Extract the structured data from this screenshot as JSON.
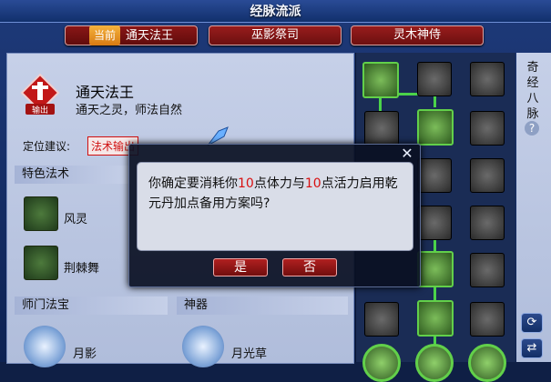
{
  "window": {
    "title": "经脉流派"
  },
  "tabs": [
    {
      "prefix": "当前",
      "label": "通天法王"
    },
    {
      "label": "巫影祭司"
    },
    {
      "label": "灵木神侍"
    }
  ],
  "class_info": {
    "name": "通天法王",
    "description": "通天之灵，师法自然",
    "icon_caption": "输出",
    "position_label": "定位建议:",
    "position_badge": "法术输出"
  },
  "sections": {
    "special_spells": "特色法术",
    "sect_treasure": "师门法宝",
    "artifact": "神器"
  },
  "skills": [
    {
      "label": "风灵",
      "icon": "whirlwind-icon"
    },
    {
      "label": "荆棘舞",
      "icon": "thorn-dance-icon"
    }
  ],
  "treasures": [
    {
      "label": "月影",
      "icon": "moon-shadow-icon"
    },
    {
      "label": "月光草",
      "icon": "moonlight-grass-icon"
    }
  ],
  "sidebar": {
    "vertical_label": "奇经八脉",
    "help": "?",
    "refresh_icon": "refresh-icon",
    "swap_icon": "swap-icon"
  },
  "dialog": {
    "text_prefix": "你确定要消耗你",
    "num1": "10",
    "text_mid": "点体力与",
    "num2": "10",
    "text_suffix": "点活力启用乾元丹加点备用方案吗?",
    "yes": "是",
    "no": "否",
    "close": "✕"
  },
  "colors": {
    "accent_red": "#d81010",
    "active_node_green": "#62d04a"
  }
}
